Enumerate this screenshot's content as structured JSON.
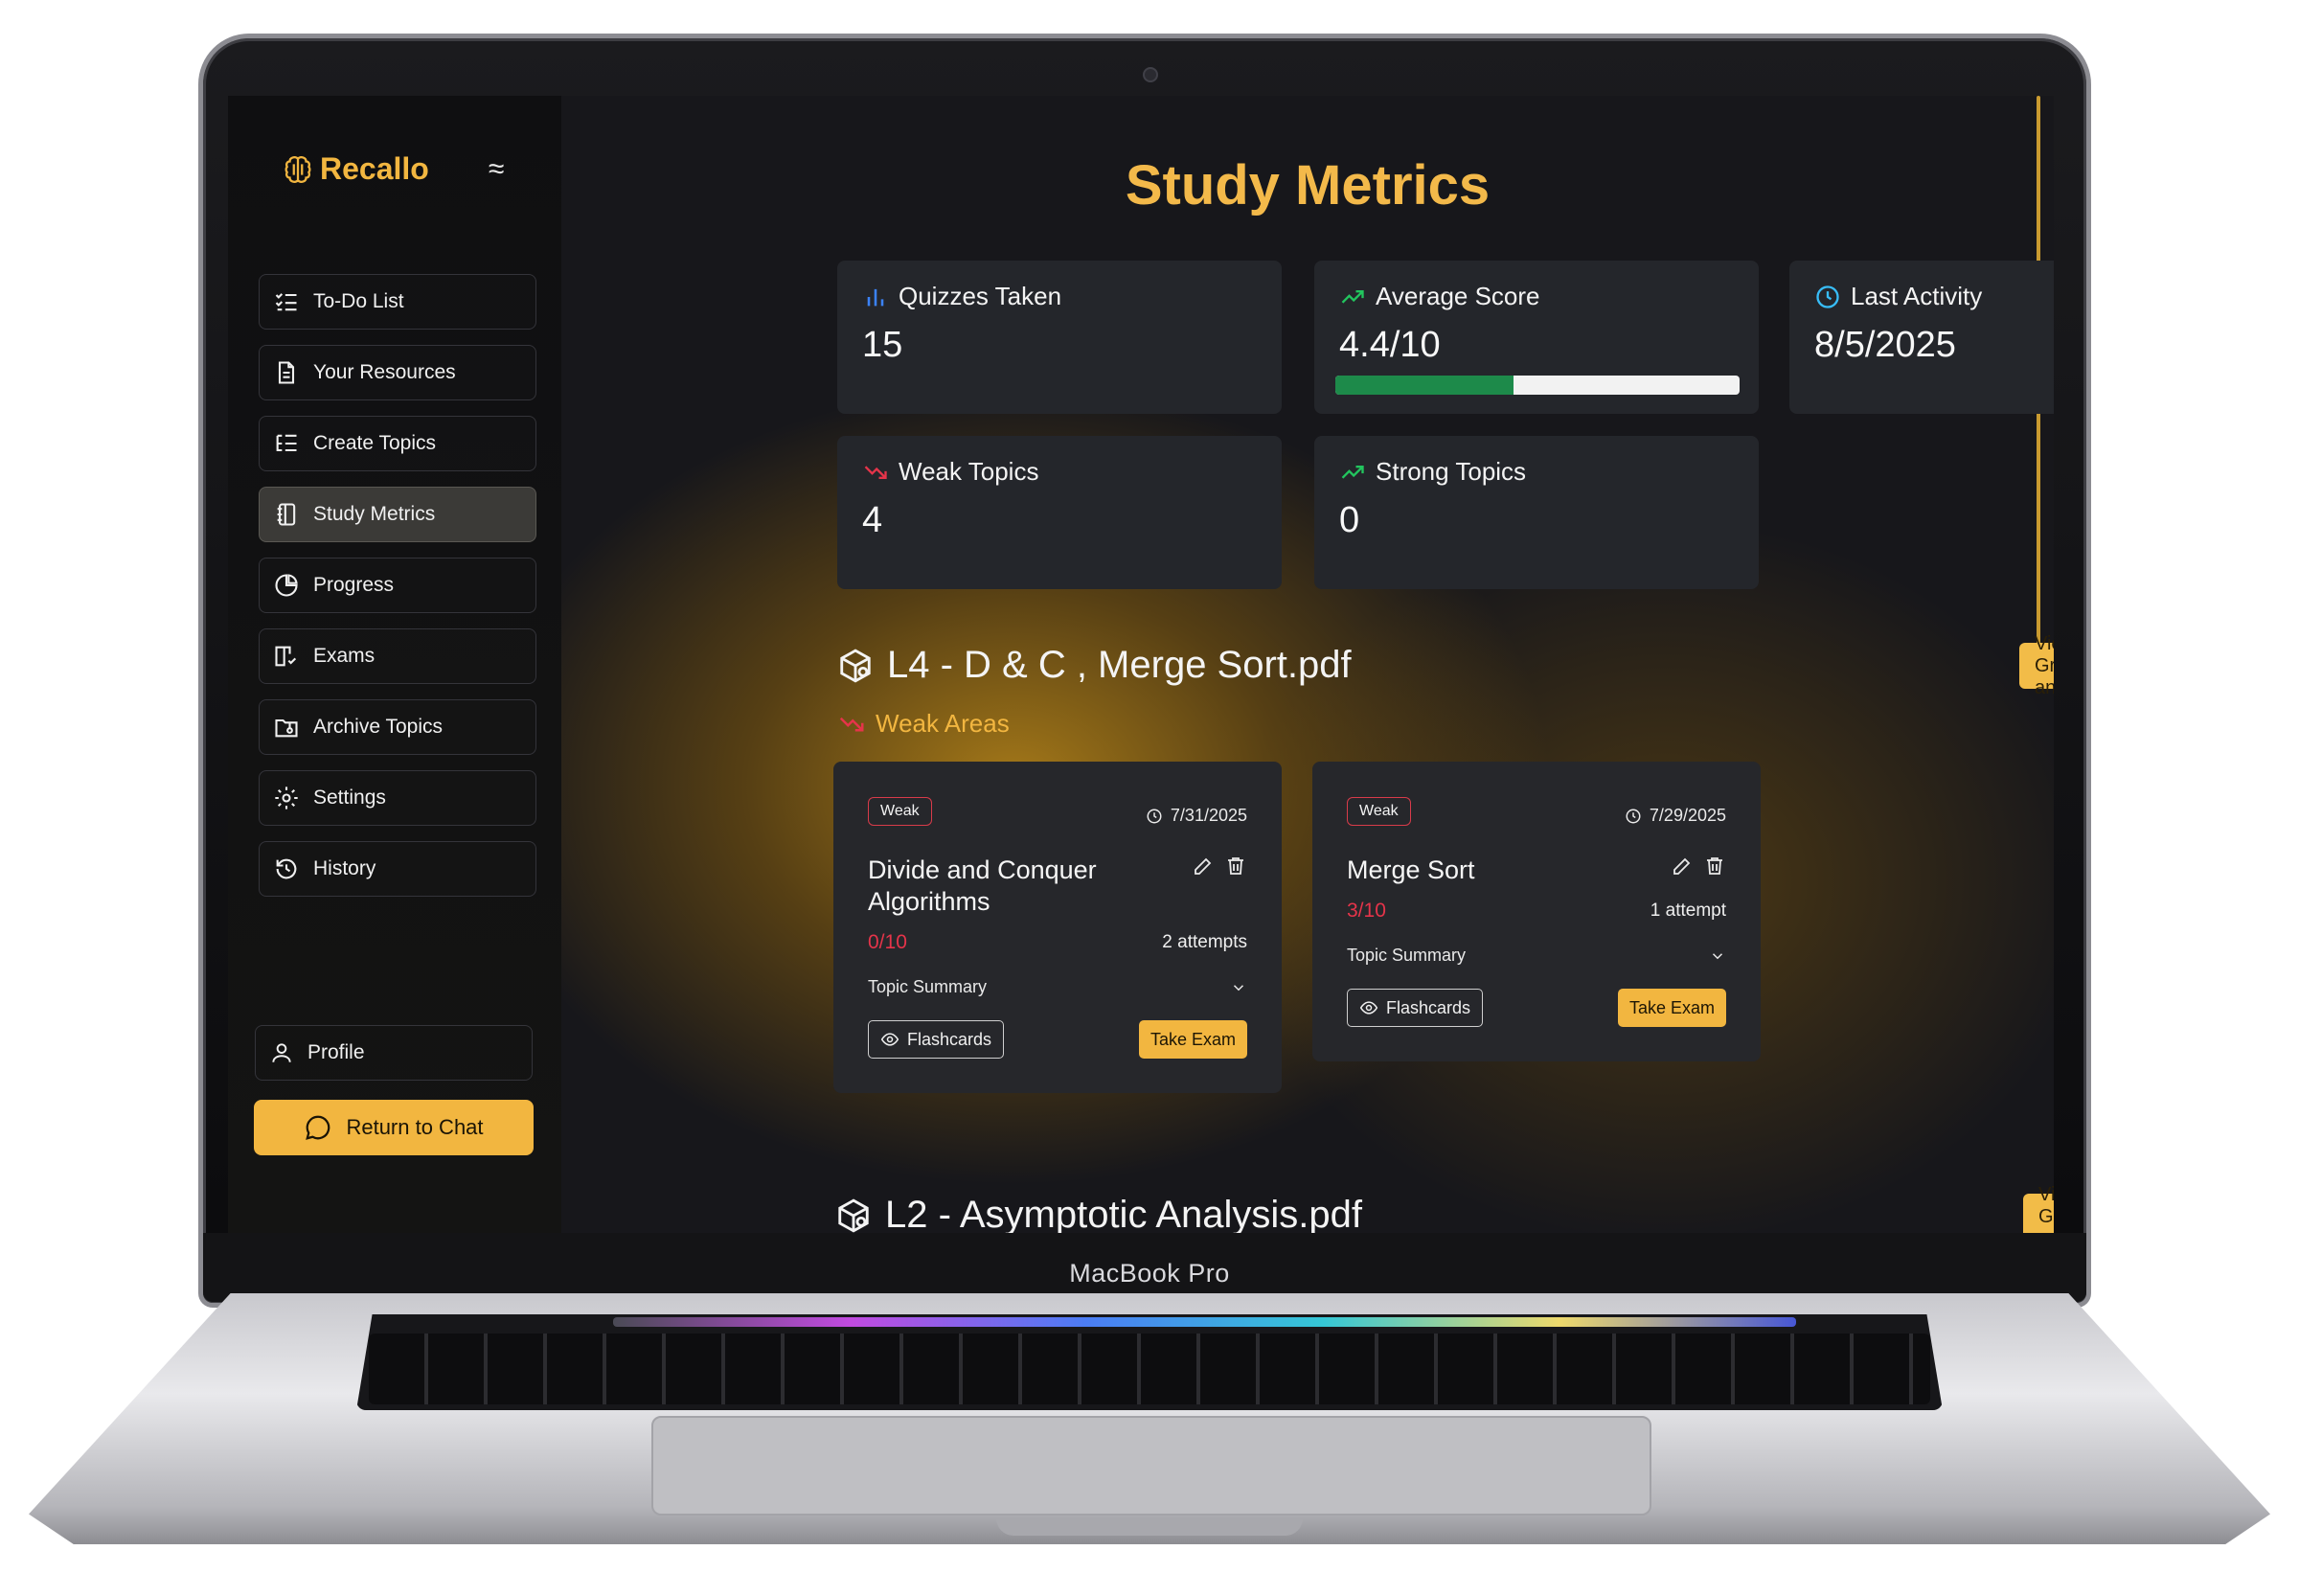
{
  "device": {
    "label": "MacBook Pro"
  },
  "sidebar": {
    "brand": "Recallo",
    "menu_toggle": "≈",
    "items": [
      {
        "label": "To-Do List",
        "icon": "checklist-icon",
        "active": false
      },
      {
        "label": "Your Resources",
        "icon": "document-icon",
        "active": false
      },
      {
        "label": "Create Topics",
        "icon": "list-tree-icon",
        "active": false
      },
      {
        "label": "Study Metrics",
        "icon": "notebook-icon",
        "active": true
      },
      {
        "label": "Progress",
        "icon": "pie-chart-icon",
        "active": false
      },
      {
        "label": "Exams",
        "icon": "book-open-check-icon",
        "active": false
      },
      {
        "label": "Archive Topics",
        "icon": "folder-archive-icon",
        "active": false
      },
      {
        "label": "Settings",
        "icon": "gear-icon",
        "active": false
      },
      {
        "label": "History",
        "icon": "history-icon",
        "active": false
      }
    ],
    "profile_label": "Profile",
    "return_label": "Return to Chat"
  },
  "main": {
    "title": "Study Metrics",
    "metrics": {
      "quizzes_taken": {
        "label": "Quizzes Taken",
        "value": "15"
      },
      "average_score": {
        "label": "Average Score",
        "value": "4.4/10",
        "fraction": 0.44
      },
      "last_activity": {
        "label": "Last Activity",
        "value": "8/5/2025"
      },
      "weak_topics": {
        "label": "Weak Topics",
        "value": "4"
      },
      "strong_topics": {
        "label": "Strong Topics",
        "value": "0"
      }
    },
    "documents": [
      {
        "title": "L4 - D & C , Merge Sort.pdf",
        "graph_button": "View Graph analysis",
        "section_label": "Weak Areas",
        "topics": [
          {
            "badge": "Weak",
            "date": "7/31/2025",
            "title": "Divide and Conquer Algorithms",
            "score": "0/10",
            "attempts": "2 attempts",
            "summary_label": "Topic Summary",
            "flashcards_label": "Flashcards",
            "exam_label": "Take Exam"
          },
          {
            "badge": "Weak",
            "date": "7/29/2025",
            "title": "Merge Sort",
            "score": "3/10",
            "attempts": "1 attempt",
            "summary_label": "Topic Summary",
            "flashcards_label": "Flashcards",
            "exam_label": "Take Exam"
          }
        ]
      },
      {
        "title": "L2 - Asymptotic Analysis.pdf",
        "graph_button": "View Graph analysis"
      }
    ]
  },
  "colors": {
    "accent": "#f2b640",
    "weak_red": "#e5344a",
    "score_fill": "#1d8a4a",
    "quizzes_icon": "#3b82f6",
    "activity_icon": "#38bdf8",
    "trend_up": "#22c55e"
  }
}
